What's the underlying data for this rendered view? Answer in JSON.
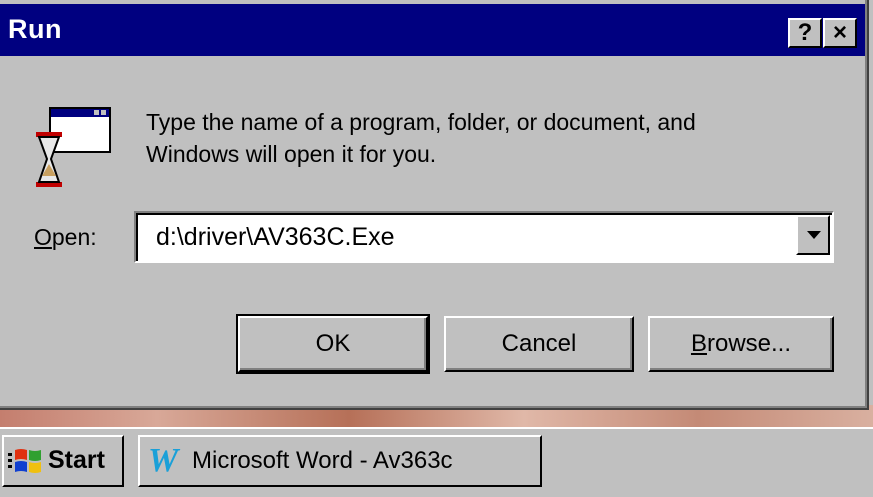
{
  "dialog": {
    "title": "Run",
    "help_button": "?",
    "close_button": "×",
    "message_line1": "Type the name of a program, folder, or document, and",
    "message_line2": "Windows will open it for you.",
    "open_label_accel": "O",
    "open_label_rest": "pen:",
    "open_value": "d:\\driver\\AV363C.Exe",
    "ok_label": "OK",
    "cancel_label": "Cancel",
    "browse_accel": "B",
    "browse_rest": "rowse..."
  },
  "taskbar": {
    "start_label": "Start",
    "tasks": [
      {
        "label": "Microsoft Word - Av363c",
        "icon": "W"
      }
    ]
  },
  "colors": {
    "title_bar": "#000080",
    "face": "#c0c0c0",
    "word_icon": "#1aa0d8"
  }
}
